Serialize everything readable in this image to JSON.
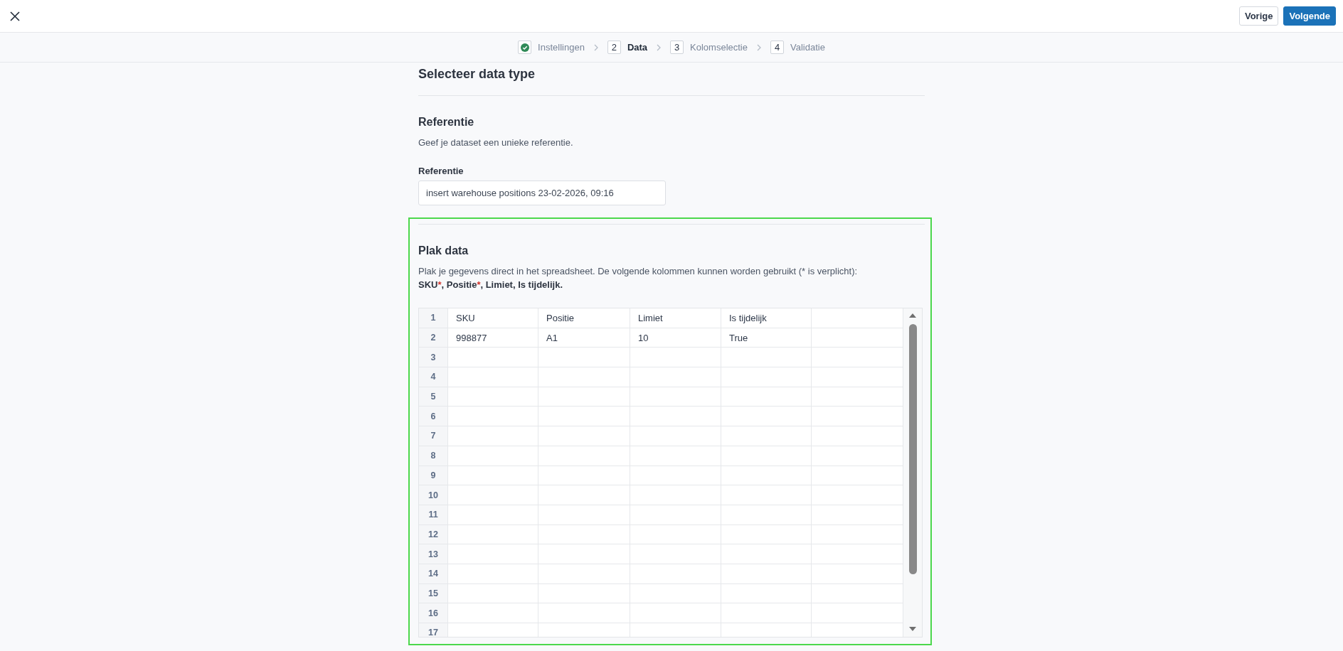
{
  "top_bar": {
    "buttons": [
      {
        "label": "Vorige",
        "kind": "secondary"
      },
      {
        "label": "Volgende",
        "kind": "primary"
      }
    ]
  },
  "stepper": {
    "steps": [
      {
        "label": "Instellingen",
        "completed": true,
        "selected": false
      },
      {
        "number": "2",
        "label": "Data",
        "completed": false,
        "selected": true
      },
      {
        "number": "3",
        "label": "Kolomselectie",
        "completed": false,
        "selected": false
      },
      {
        "number": "4",
        "label": "Validatie",
        "completed": false,
        "selected": false
      }
    ]
  },
  "data_type_section": {
    "title": "Selecteer data type"
  },
  "reference_section": {
    "title": "Referentie",
    "description": "Geef je dataset een unieke referentie.",
    "field": {
      "label": "Referentie",
      "value": "insert warehouse positions 23-02-2026, 09:16"
    }
  },
  "paste_section": {
    "highlighted": true,
    "title": "Plak data",
    "description": "Plak je gegevens direct in het spreadsheet. De volgende kolommen kunnen worden gebruikt (* is verplicht):",
    "column_list": [
      {
        "text": "SKU",
        "kind": "name"
      },
      {
        "text": "*",
        "kind": "required"
      },
      {
        "text": ", Positie",
        "kind": "name"
      },
      {
        "text": "*",
        "kind": "required"
      },
      {
        "text": ", Limiet, Is tijdelijk.",
        "kind": "name"
      }
    ],
    "spreadsheet": {
      "rows": [
        {
          "number": "1",
          "cells": [
            "SKU",
            "Positie",
            "Limiet",
            "Is tijdelijk"
          ]
        },
        {
          "number": "2",
          "cells": [
            "998877",
            "A1",
            "10",
            "True"
          ]
        },
        {
          "number": "3"
        },
        {
          "number": "4"
        },
        {
          "number": "5"
        },
        {
          "number": "6"
        },
        {
          "number": "7"
        },
        {
          "number": "8"
        },
        {
          "number": "9"
        },
        {
          "number": "10"
        },
        {
          "number": "11"
        },
        {
          "number": "12"
        },
        {
          "number": "13"
        },
        {
          "number": "14"
        },
        {
          "number": "15"
        },
        {
          "number": "16"
        },
        {
          "number": "17"
        }
      ]
    }
  }
}
